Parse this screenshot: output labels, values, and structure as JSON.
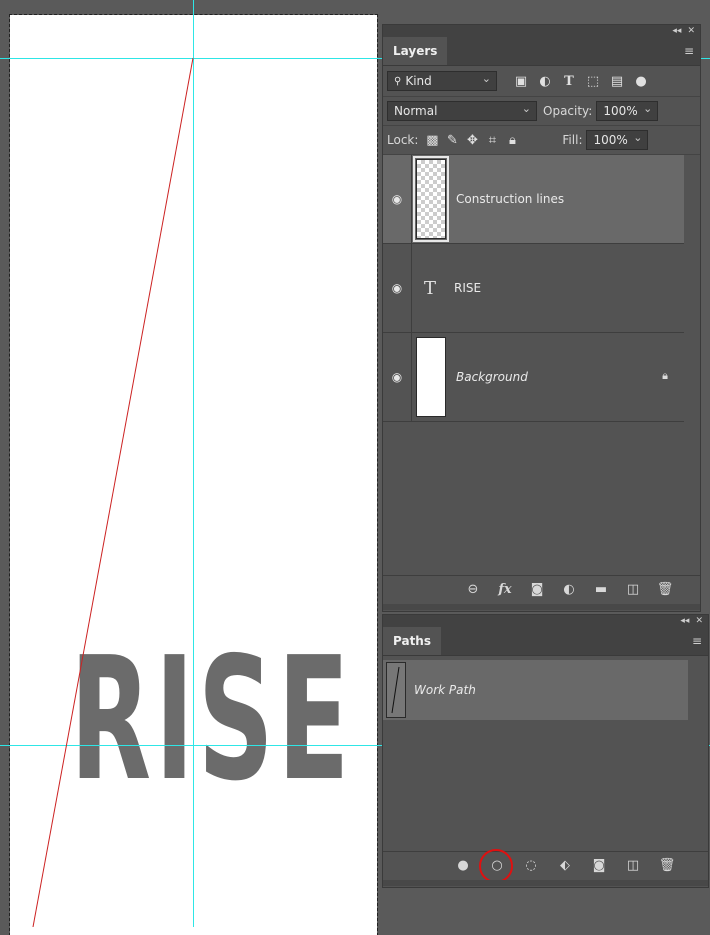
{
  "canvas": {
    "text": "RISE"
  },
  "layers_panel": {
    "tab": "Layers",
    "kind": {
      "value": "Kind"
    },
    "blend_mode": "Normal",
    "opacity_label": "Opacity:",
    "opacity_value": "100%",
    "lock_label": "Lock:",
    "fill_label": "Fill:",
    "fill_value": "100%",
    "layers": [
      {
        "name": "Construction lines",
        "type": "pixel",
        "visible": true,
        "selected": true
      },
      {
        "name": "RISE",
        "type": "text",
        "visible": true
      },
      {
        "name": "Background",
        "type": "background",
        "visible": true,
        "locked": true
      }
    ],
    "filter_icons": [
      "image-filter-icon",
      "adjustment-filter-icon",
      "type-filter-icon",
      "shape-filter-icon",
      "smart-object-filter-icon",
      "filter-toggle-icon"
    ],
    "lock_icons": [
      "lock-transparent-icon",
      "lock-image-icon",
      "lock-position-icon",
      "lock-artboard-icon",
      "lock-all-icon"
    ],
    "footer_icons": [
      "link-layers-icon",
      "fx-icon",
      "add-mask-icon",
      "adjustment-layer-icon",
      "new-group-icon",
      "new-layer-icon",
      "delete-icon"
    ]
  },
  "paths_panel": {
    "tab": "Paths",
    "paths": [
      {
        "name": "Work Path",
        "selected": true
      }
    ],
    "footer_icons": [
      "fill-path-icon",
      "stroke-path-icon",
      "load-selection-icon",
      "make-work-path-icon",
      "add-mask-icon",
      "new-path-icon",
      "delete-icon"
    ],
    "highlight": "stroke-path-icon"
  },
  "colors": {
    "guide": "#2ee6e6",
    "construction_line": "#cc2222",
    "highlight_circle": "#e01010",
    "text_gray": "#6b6b6b"
  }
}
